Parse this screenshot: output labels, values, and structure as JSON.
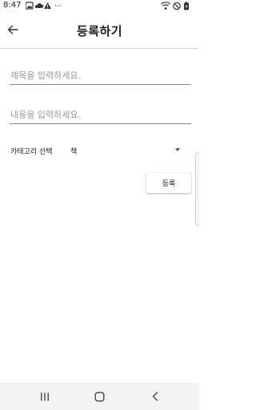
{
  "status_bar": {
    "time": "8:47",
    "menu_dots": "···"
  },
  "app_bar": {
    "title": "등록하기"
  },
  "form": {
    "title_placeholder": "제목을 입력하세요.",
    "content_placeholder": "내용을 입력하세요.",
    "category_label": "카테고리 선택",
    "category_value": "책",
    "submit_label": "등록"
  },
  "colors": {
    "divider": "#d9d9d9",
    "placeholder": "#9a9a9a",
    "nav_bar_bg": "#f3f3f3"
  }
}
